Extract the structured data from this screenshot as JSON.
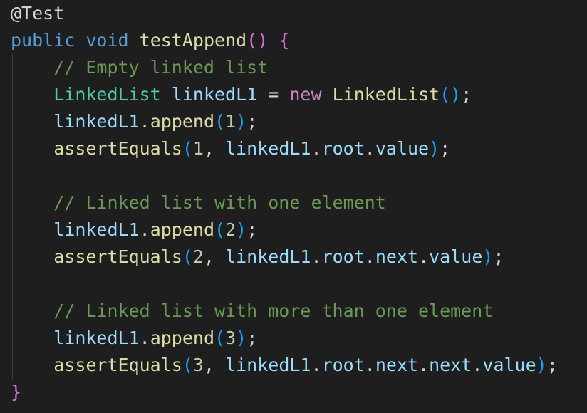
{
  "editor": {
    "language": "java",
    "theme_colors": {
      "background": "#1e1e1e",
      "keyword": "#569cd6",
      "control_keyword": "#c586c0",
      "type": "#4ec9b0",
      "function": "#dcdcaa",
      "variable": "#9cdcfe",
      "number": "#b5cea8",
      "comment": "#6a9955",
      "bracket_level1": "#da70d6",
      "bracket_level2": "#179fff",
      "bracket_level3": "#ffd700"
    },
    "lines": [
      {
        "tokens": [
          {
            "t": "@Test",
            "c": "t-pun"
          }
        ]
      },
      {
        "tokens": [
          {
            "t": "public",
            "c": "t-kw"
          },
          {
            "t": " ",
            "c": "t-pun"
          },
          {
            "t": "void",
            "c": "t-kw"
          },
          {
            "t": " ",
            "c": "t-pun"
          },
          {
            "t": "testAppend",
            "c": "t-fn"
          },
          {
            "t": "()",
            "c": "t-p1"
          },
          {
            "t": " ",
            "c": "t-pun"
          },
          {
            "t": "{",
            "c": "t-p1"
          }
        ]
      },
      {
        "tokens": [
          {
            "t": "    ",
            "c": "t-pun"
          },
          {
            "t": "// Empty linked list",
            "c": "t-cmt"
          }
        ]
      },
      {
        "tokens": [
          {
            "t": "    ",
            "c": "t-pun"
          },
          {
            "t": "LinkedList",
            "c": "t-type"
          },
          {
            "t": " ",
            "c": "t-pun"
          },
          {
            "t": "linkedL1",
            "c": "t-var"
          },
          {
            "t": " = ",
            "c": "t-pun"
          },
          {
            "t": "new",
            "c": "t-kw2"
          },
          {
            "t": " ",
            "c": "t-pun"
          },
          {
            "t": "LinkedList",
            "c": "t-fn"
          },
          {
            "t": "()",
            "c": "t-p2"
          },
          {
            "t": ";",
            "c": "t-pun"
          }
        ]
      },
      {
        "tokens": [
          {
            "t": "    ",
            "c": "t-pun"
          },
          {
            "t": "linkedL1",
            "c": "t-var"
          },
          {
            "t": ".",
            "c": "t-pun"
          },
          {
            "t": "append",
            "c": "t-fn"
          },
          {
            "t": "(",
            "c": "t-p2"
          },
          {
            "t": "1",
            "c": "t-num"
          },
          {
            "t": ")",
            "c": "t-p2"
          },
          {
            "t": ";",
            "c": "t-pun"
          }
        ]
      },
      {
        "tokens": [
          {
            "t": "    ",
            "c": "t-pun"
          },
          {
            "t": "assertEquals",
            "c": "t-fn"
          },
          {
            "t": "(",
            "c": "t-p2"
          },
          {
            "t": "1",
            "c": "t-num"
          },
          {
            "t": ", ",
            "c": "t-pun"
          },
          {
            "t": "linkedL1",
            "c": "t-var"
          },
          {
            "t": ".",
            "c": "t-pun"
          },
          {
            "t": "root",
            "c": "t-var"
          },
          {
            "t": ".",
            "c": "t-pun"
          },
          {
            "t": "value",
            "c": "t-var"
          },
          {
            "t": ")",
            "c": "t-p2"
          },
          {
            "t": ";",
            "c": "t-pun"
          }
        ]
      },
      {
        "tokens": []
      },
      {
        "tokens": [
          {
            "t": "    ",
            "c": "t-pun"
          },
          {
            "t": "// Linked list with one element",
            "c": "t-cmt"
          }
        ]
      },
      {
        "tokens": [
          {
            "t": "    ",
            "c": "t-pun"
          },
          {
            "t": "linkedL1",
            "c": "t-var"
          },
          {
            "t": ".",
            "c": "t-pun"
          },
          {
            "t": "append",
            "c": "t-fn"
          },
          {
            "t": "(",
            "c": "t-p2"
          },
          {
            "t": "2",
            "c": "t-num"
          },
          {
            "t": ")",
            "c": "t-p2"
          },
          {
            "t": ";",
            "c": "t-pun"
          }
        ]
      },
      {
        "tokens": [
          {
            "t": "    ",
            "c": "t-pun"
          },
          {
            "t": "assertEquals",
            "c": "t-fn"
          },
          {
            "t": "(",
            "c": "t-p2"
          },
          {
            "t": "2",
            "c": "t-num"
          },
          {
            "t": ", ",
            "c": "t-pun"
          },
          {
            "t": "linkedL1",
            "c": "t-var"
          },
          {
            "t": ".",
            "c": "t-pun"
          },
          {
            "t": "root",
            "c": "t-var"
          },
          {
            "t": ".",
            "c": "t-pun"
          },
          {
            "t": "next",
            "c": "t-var"
          },
          {
            "t": ".",
            "c": "t-pun"
          },
          {
            "t": "value",
            "c": "t-var"
          },
          {
            "t": ")",
            "c": "t-p2"
          },
          {
            "t": ";",
            "c": "t-pun"
          }
        ]
      },
      {
        "tokens": []
      },
      {
        "tokens": [
          {
            "t": "    ",
            "c": "t-pun"
          },
          {
            "t": "// Linked list with more than one element",
            "c": "t-cmt"
          }
        ]
      },
      {
        "tokens": [
          {
            "t": "    ",
            "c": "t-pun"
          },
          {
            "t": "linkedL1",
            "c": "t-var"
          },
          {
            "t": ".",
            "c": "t-pun"
          },
          {
            "t": "append",
            "c": "t-fn"
          },
          {
            "t": "(",
            "c": "t-p2"
          },
          {
            "t": "3",
            "c": "t-num"
          },
          {
            "t": ")",
            "c": "t-p2"
          },
          {
            "t": ";",
            "c": "t-pun"
          }
        ]
      },
      {
        "tokens": [
          {
            "t": "    ",
            "c": "t-pun"
          },
          {
            "t": "assertEquals",
            "c": "t-fn"
          },
          {
            "t": "(",
            "c": "t-p2"
          },
          {
            "t": "3",
            "c": "t-num"
          },
          {
            "t": ", ",
            "c": "t-pun"
          },
          {
            "t": "linkedL1",
            "c": "t-var"
          },
          {
            "t": ".",
            "c": "t-pun"
          },
          {
            "t": "root",
            "c": "t-var"
          },
          {
            "t": ".",
            "c": "t-pun"
          },
          {
            "t": "next",
            "c": "t-var"
          },
          {
            "t": ".",
            "c": "t-pun"
          },
          {
            "t": "next",
            "c": "t-var"
          },
          {
            "t": ".",
            "c": "t-pun"
          },
          {
            "t": "value",
            "c": "t-var"
          },
          {
            "t": ")",
            "c": "t-p2"
          },
          {
            "t": ";",
            "c": "t-pun"
          }
        ]
      },
      {
        "tokens": [
          {
            "t": "}",
            "c": "t-p1"
          }
        ]
      }
    ]
  }
}
